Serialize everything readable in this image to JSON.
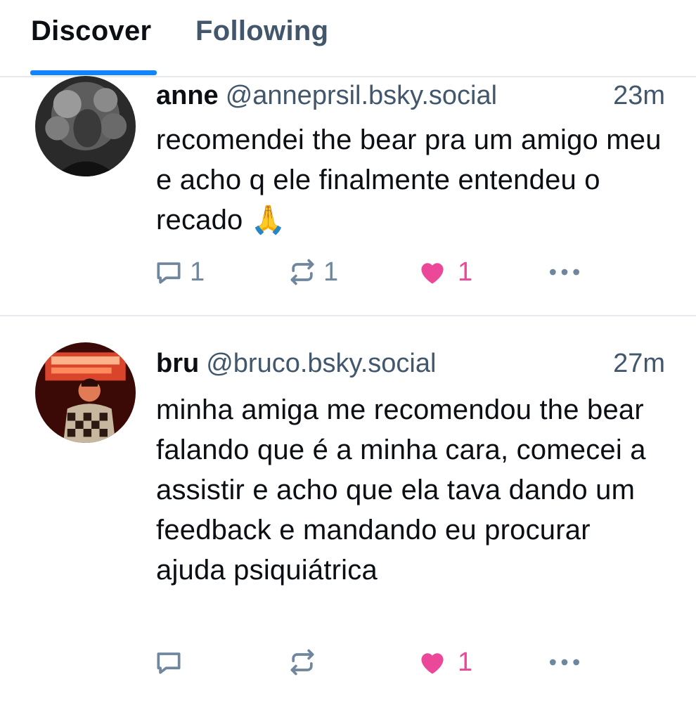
{
  "tabs": {
    "discover": "Discover",
    "following": "Following",
    "active": "Discover",
    "accent_color": "#1185fe"
  },
  "posts": [
    {
      "display_name": "anne",
      "handle": "@anneprsil.bsky.social",
      "time": "23m",
      "text": "recomendei the bear pra um amigo meu e acho q ele finalmente entendeu o recado 🙏",
      "avatar_icon": "avatar-anne",
      "reply_count": "1",
      "repost_count": "1",
      "like_count": "1",
      "liked": true
    },
    {
      "display_name": "bru",
      "handle": "@bruco.bsky.social",
      "time": "27m",
      "text": "minha amiga me recomendou the bear falando que é a minha cara, comecei a assistir e acho que ela tava dando um feedback e mandando eu procurar ajuda psiquiátrica",
      "avatar_icon": "avatar-bru",
      "reply_count": "",
      "repost_count": "",
      "like_count": "1",
      "liked": true
    }
  ],
  "colors": {
    "like": "#ec4899",
    "muted": "#42576c",
    "icon": "#6f869f"
  }
}
